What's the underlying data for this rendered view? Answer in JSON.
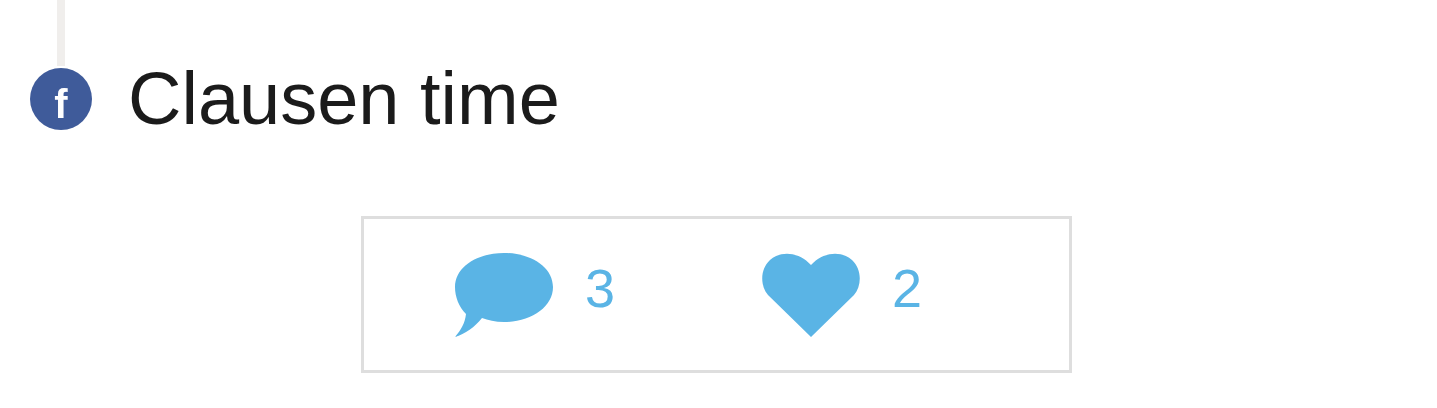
{
  "post": {
    "source_badge": "f",
    "title": "Clausen time"
  },
  "stats": [
    {
      "kind": "comment",
      "count": "3"
    },
    {
      "kind": "like",
      "count": "2"
    }
  ]
}
